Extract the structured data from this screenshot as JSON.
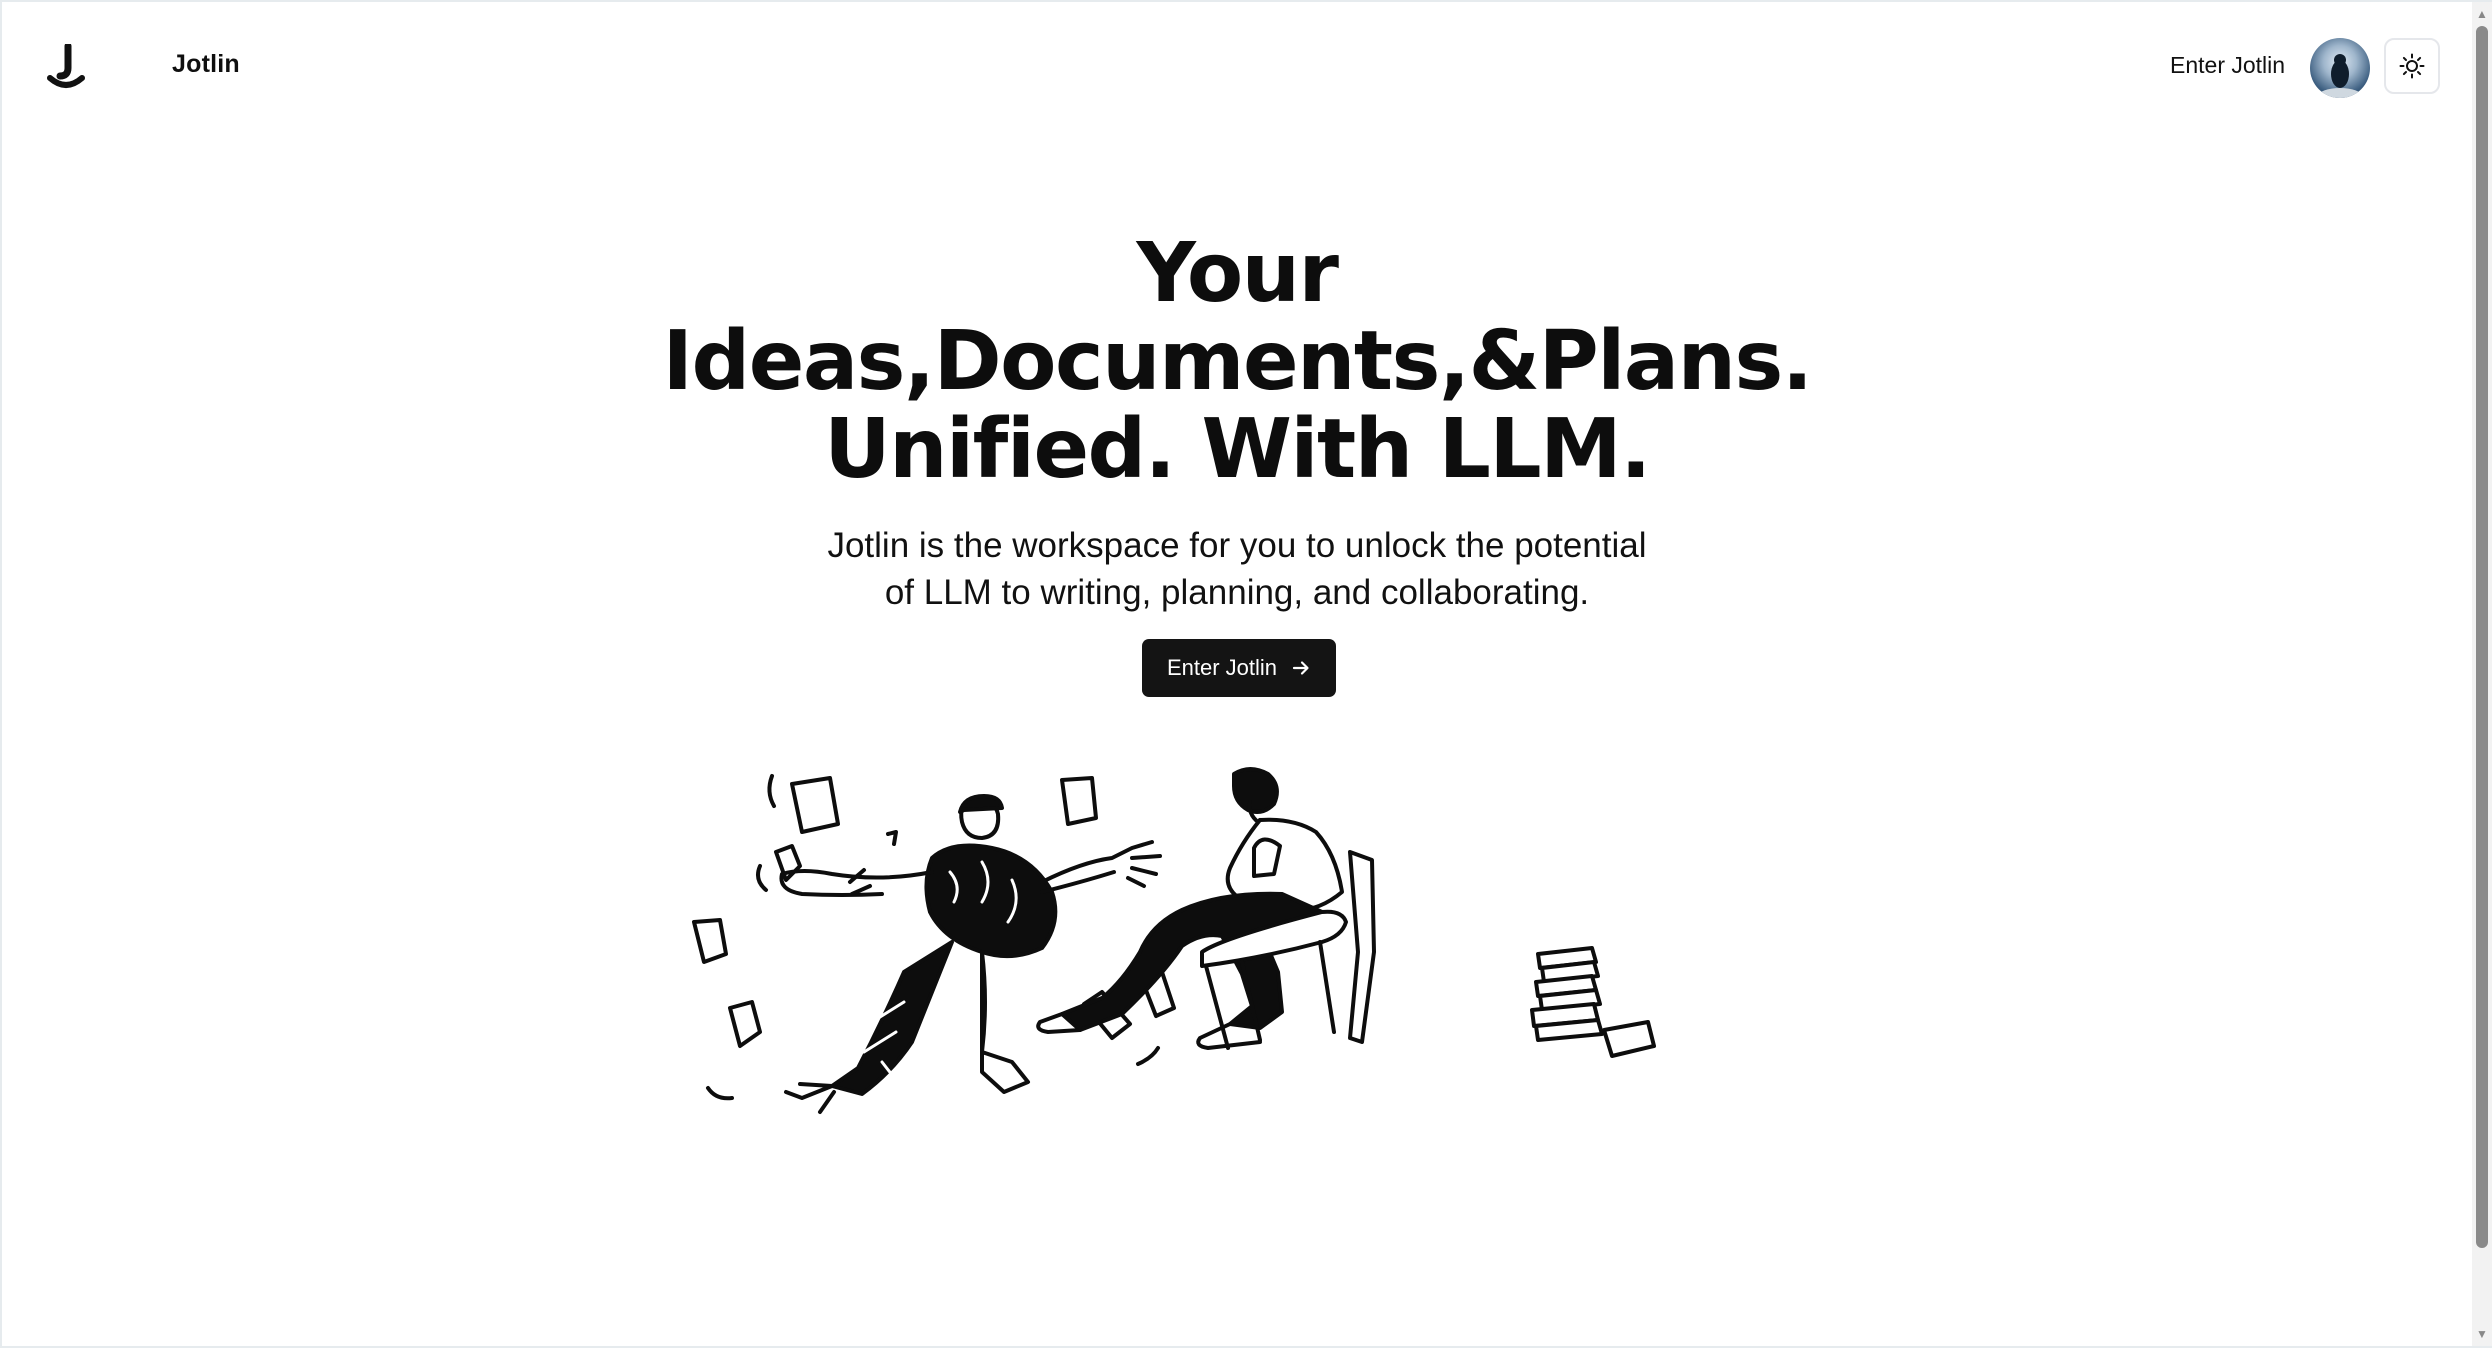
{
  "header": {
    "brand": "Jotlin",
    "nav_link": "Enter Jotlin"
  },
  "hero": {
    "title_lines": [
      "Your",
      "Ideas,Documents,&Plans.",
      "Unified. With LLM."
    ],
    "subtitle_lines": [
      "Jotlin is the workspace for you to unlock the potential",
      "of LLM to writing, planning, and collaborating."
    ],
    "cta_label": "Enter Jotlin"
  },
  "icons": {
    "logo": "jotlin-logo-icon",
    "theme": "sun-icon",
    "cta_arrow": "arrow-right-icon"
  },
  "colors": {
    "primary": "#141414",
    "background": "#ffffff",
    "text": "#0f0f0f"
  }
}
